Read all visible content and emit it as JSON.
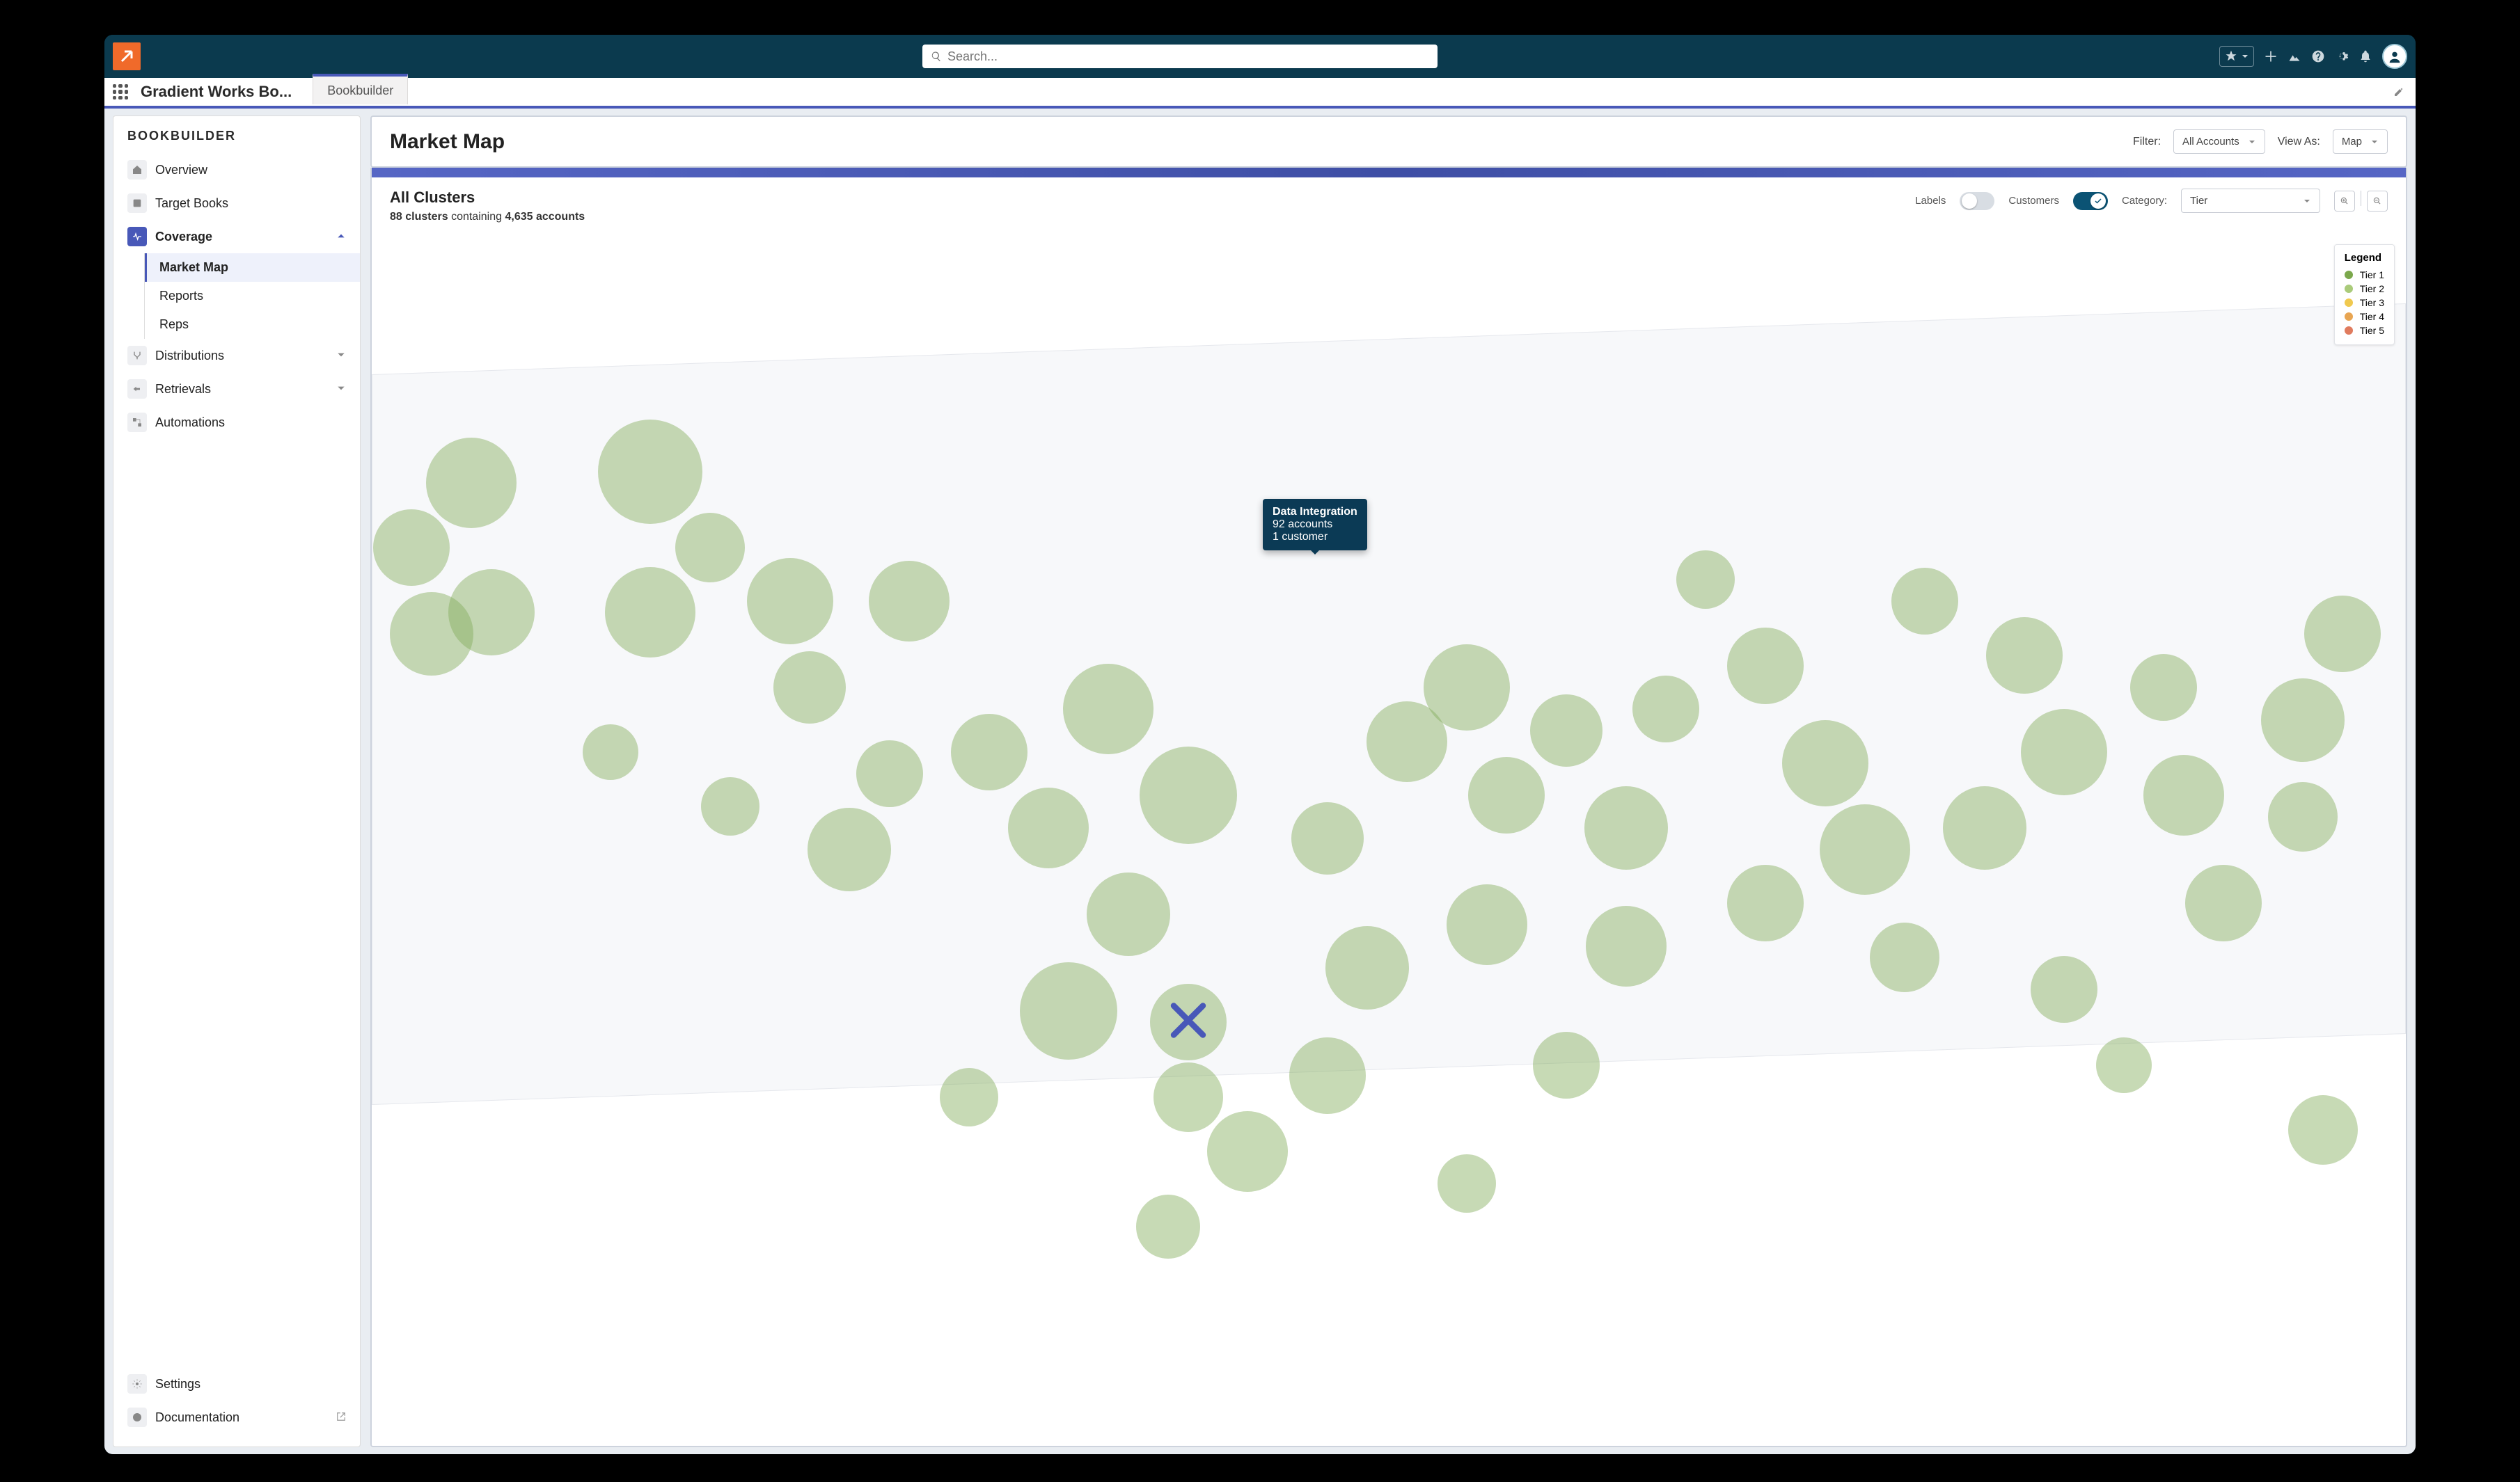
{
  "topbar": {
    "search_placeholder": "Search..."
  },
  "nav": {
    "app_name": "Gradient Works Bo...",
    "tab": "Bookbuilder"
  },
  "sidebar": {
    "title": "BOOKBUILDER",
    "overview": {
      "label": "Overview"
    },
    "target_books": {
      "label": "Target Books"
    },
    "coverage": {
      "label": "Coverage",
      "expanded": true,
      "children": {
        "market_map": "Market Map",
        "reports": "Reports",
        "reps": "Reps"
      }
    },
    "distributions": {
      "label": "Distributions"
    },
    "retrievals": {
      "label": "Retrievals"
    },
    "automations": {
      "label": "Automations"
    },
    "settings": {
      "label": "Settings"
    },
    "documentation": {
      "label": "Documentation"
    }
  },
  "page": {
    "title": "Market Map",
    "filter_label": "Filter:",
    "filter_value": "All Accounts",
    "viewas_label": "View As:",
    "viewas_value": "Map"
  },
  "clusters": {
    "title": "All Clusters",
    "count": "88 clusters",
    "containing_word": "containing",
    "accounts": "4,635 accounts",
    "labels_label": "Labels",
    "labels_on": false,
    "customers_label": "Customers",
    "customers_on": true,
    "category_label": "Category:",
    "category_value": "Tier"
  },
  "tooltip": {
    "title": "Data Integration",
    "line1": "92 accounts",
    "line2": "1 customer"
  },
  "legend": {
    "title": "Legend",
    "items": [
      {
        "label": "Tier 1",
        "color": "#7ba84c"
      },
      {
        "label": "Tier 2",
        "color": "#aacb7a"
      },
      {
        "label": "Tier 3",
        "color": "#f0c94f"
      },
      {
        "label": "Tier 4",
        "color": "#e8a552"
      },
      {
        "label": "Tier 5",
        "color": "#e07b5e"
      }
    ]
  },
  "chart_data": {
    "type": "scatter",
    "title": "Market Map — All Clusters",
    "bubbles": [
      {
        "x": 2,
        "y": 29,
        "r": 55
      },
      {
        "x": 5,
        "y": 23,
        "r": 65
      },
      {
        "x": 3,
        "y": 37,
        "r": 60
      },
      {
        "x": 6,
        "y": 35,
        "r": 62
      },
      {
        "x": 14,
        "y": 22,
        "r": 75
      },
      {
        "x": 17,
        "y": 29,
        "r": 50
      },
      {
        "x": 14,
        "y": 35,
        "r": 65
      },
      {
        "x": 21,
        "y": 34,
        "r": 62
      },
      {
        "x": 27,
        "y": 34,
        "r": 58
      },
      {
        "x": 22,
        "y": 42,
        "r": 52
      },
      {
        "x": 26,
        "y": 50,
        "r": 48
      },
      {
        "x": 24,
        "y": 57,
        "r": 60
      },
      {
        "x": 31,
        "y": 48,
        "r": 55
      },
      {
        "x": 34,
        "y": 55,
        "r": 58
      },
      {
        "x": 37,
        "y": 44,
        "r": 65
      },
      {
        "x": 41,
        "y": 52,
        "r": 70
      },
      {
        "x": 38,
        "y": 63,
        "r": 60
      },
      {
        "x": 35,
        "y": 72,
        "r": 70
      },
      {
        "x": 41,
        "y": 73,
        "r": 55
      },
      {
        "x": 44,
        "y": 85,
        "r": 58
      },
      {
        "x": 48,
        "y": 56,
        "r": 52
      },
      {
        "x": 52,
        "y": 47,
        "r": 58
      },
      {
        "x": 55,
        "y": 42,
        "r": 62
      },
      {
        "x": 57,
        "y": 52,
        "r": 55
      },
      {
        "x": 56,
        "y": 64,
        "r": 58
      },
      {
        "x": 50,
        "y": 68,
        "r": 60
      },
      {
        "x": 48,
        "y": 78,
        "r": 55
      },
      {
        "x": 41,
        "y": 80,
        "r": 50
      },
      {
        "x": 60,
        "y": 77,
        "r": 48
      },
      {
        "x": 63,
        "y": 66,
        "r": 58
      },
      {
        "x": 63,
        "y": 55,
        "r": 60
      },
      {
        "x": 60,
        "y": 46,
        "r": 52
      },
      {
        "x": 65,
        "y": 44,
        "r": 48
      },
      {
        "x": 70,
        "y": 40,
        "r": 55
      },
      {
        "x": 73,
        "y": 49,
        "r": 62
      },
      {
        "x": 75,
        "y": 57,
        "r": 65
      },
      {
        "x": 70,
        "y": 62,
        "r": 55
      },
      {
        "x": 77,
        "y": 67,
        "r": 50
      },
      {
        "x": 81,
        "y": 55,
        "r": 60
      },
      {
        "x": 85,
        "y": 48,
        "r": 62
      },
      {
        "x": 83,
        "y": 39,
        "r": 55
      },
      {
        "x": 90,
        "y": 42,
        "r": 48
      },
      {
        "x": 91,
        "y": 52,
        "r": 58
      },
      {
        "x": 93,
        "y": 62,
        "r": 55
      },
      {
        "x": 97,
        "y": 45,
        "r": 60
      },
      {
        "x": 97,
        "y": 54,
        "r": 50
      },
      {
        "x": 99,
        "y": 37,
        "r": 55
      },
      {
        "x": 55,
        "y": 88,
        "r": 42
      },
      {
        "x": 40,
        "y": 92,
        "r": 46
      },
      {
        "x": 30,
        "y": 80,
        "r": 42
      },
      {
        "x": 85,
        "y": 70,
        "r": 48
      },
      {
        "x": 88,
        "y": 77,
        "r": 40
      },
      {
        "x": 98,
        "y": 83,
        "r": 50
      },
      {
        "x": 12,
        "y": 48,
        "r": 40
      },
      {
        "x": 18,
        "y": 53,
        "r": 42
      },
      {
        "x": 78,
        "y": 34,
        "r": 48
      },
      {
        "x": 67,
        "y": 32,
        "r": 42
      }
    ],
    "marker": {
      "x": 41,
      "y": 73
    },
    "xlim": [
      0,
      100
    ],
    "ylim": [
      0,
      100
    ]
  }
}
